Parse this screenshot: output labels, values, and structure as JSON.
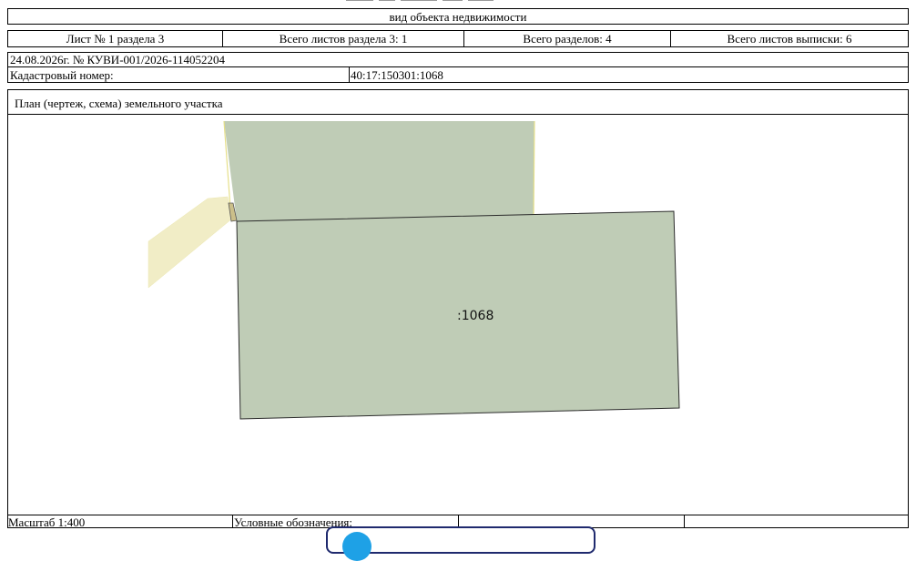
{
  "header": {
    "object_type": "вид объекта недвижимости"
  },
  "sheet_row": {
    "sheet_of_section": "Лист № 1 раздела 3",
    "total_sheets_section": "Всего листов раздела 3: 1",
    "total_sections": "Всего разделов: 4",
    "total_sheets_extract": "Всего листов выписки: 6"
  },
  "document": {
    "date_number": "24.08.2026г. № КУВИ-001/2026-114052204",
    "cadastral_label": "Кадастровый номер:",
    "cadastral_number": "40:17:150301:1068"
  },
  "plan": {
    "title": "План (чертеж, схема) земельного участка",
    "parcel_label": ":1068",
    "colors": {
      "main_parcel_fill": "#bfccb6",
      "neighbor_fill": "#f1edc6",
      "neighbor_border": "#e6e08a",
      "parcel_border": "#2b2b2b"
    }
  },
  "footer": {
    "scale": "Масштаб 1:400",
    "legend_label": "Условные обозначения:"
  },
  "overlay": {
    "badge_icon": "blue-circle-icon"
  }
}
